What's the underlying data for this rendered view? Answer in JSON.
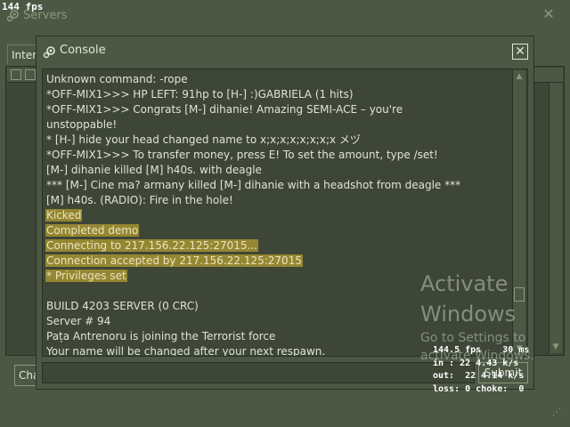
{
  "overlay": {
    "fps": "144 fps"
  },
  "servers_window": {
    "title": "Servers",
    "tab_label": "Internet",
    "change_button": "Change filters",
    "close_glyph": "✕",
    "scroll_up_glyph": "▲",
    "scroll_down_glyph": "▼",
    "grip_glyph": "⋰"
  },
  "console_window": {
    "title": "Console",
    "close_glyph": "✕",
    "submit_label": "Submit",
    "scroll_up_glyph": "▲",
    "scroll_down_glyph": "▼",
    "lines": [
      {
        "text": "Unknown command: -rope",
        "hl": false
      },
      {
        "text": "*OFF-MIX1>>> HP LEFT: 91hp to [H-] :)GABRIELA (1 hits)",
        "hl": false
      },
      {
        "text": "*OFF-MIX1>>> Congrats [M-] dihanie! Amazing SEMI-ACE – you're",
        "hl": false
      },
      {
        "text": "unstoppable!",
        "hl": false
      },
      {
        "text": "* [H-] hide your head changed name to x;x;x;x;x;x;x;x メヅ",
        "hl": false
      },
      {
        "text": "*OFF-MIX1>>> To transfer money, press E! To set the amount, type /set!",
        "hl": false
      },
      {
        "text": "[M-] dihanie killed [M] h40s. with deagle",
        "hl": false
      },
      {
        "text": "*** [M-] Cine ma? armany killed [M-] dihanie with a headshot from deagle ***",
        "hl": false
      },
      {
        "text": "[M] h40s. (RADIO): Fire in the hole!",
        "hl": false
      },
      {
        "text": "Kicked",
        "hl": true
      },
      {
        "text": "Completed demo",
        "hl": true
      },
      {
        "text": "Connecting to 217.156.22.125:27015...",
        "hl": true
      },
      {
        "text": "Connection accepted by 217.156.22.125:27015",
        "hl": true
      },
      {
        "text": "* Privileges set",
        "hl": true
      },
      {
        "text": "",
        "hl": false
      },
      {
        "text": "BUILD 4203 SERVER (0 CRC)",
        "hl": false
      },
      {
        "text": "Server # 94",
        "hl": false
      },
      {
        "text": "Pața Antrenoru is joining the Terrorist force",
        "hl": false
      },
      {
        "text": "Your name will be changed after your next respawn.",
        "hl": false
      }
    ]
  },
  "watermark": {
    "title": "Activate\nWindows",
    "subtitle": "Go to Settings to\nactivate Windows."
  },
  "netgraph": {
    "line1": "144.5 fps    30 ms",
    "line2": "in : 22 4.43 k/s",
    "line3": "out:  22 4.14 k/s",
    "line4": "loss: 0 choke:  0"
  }
}
